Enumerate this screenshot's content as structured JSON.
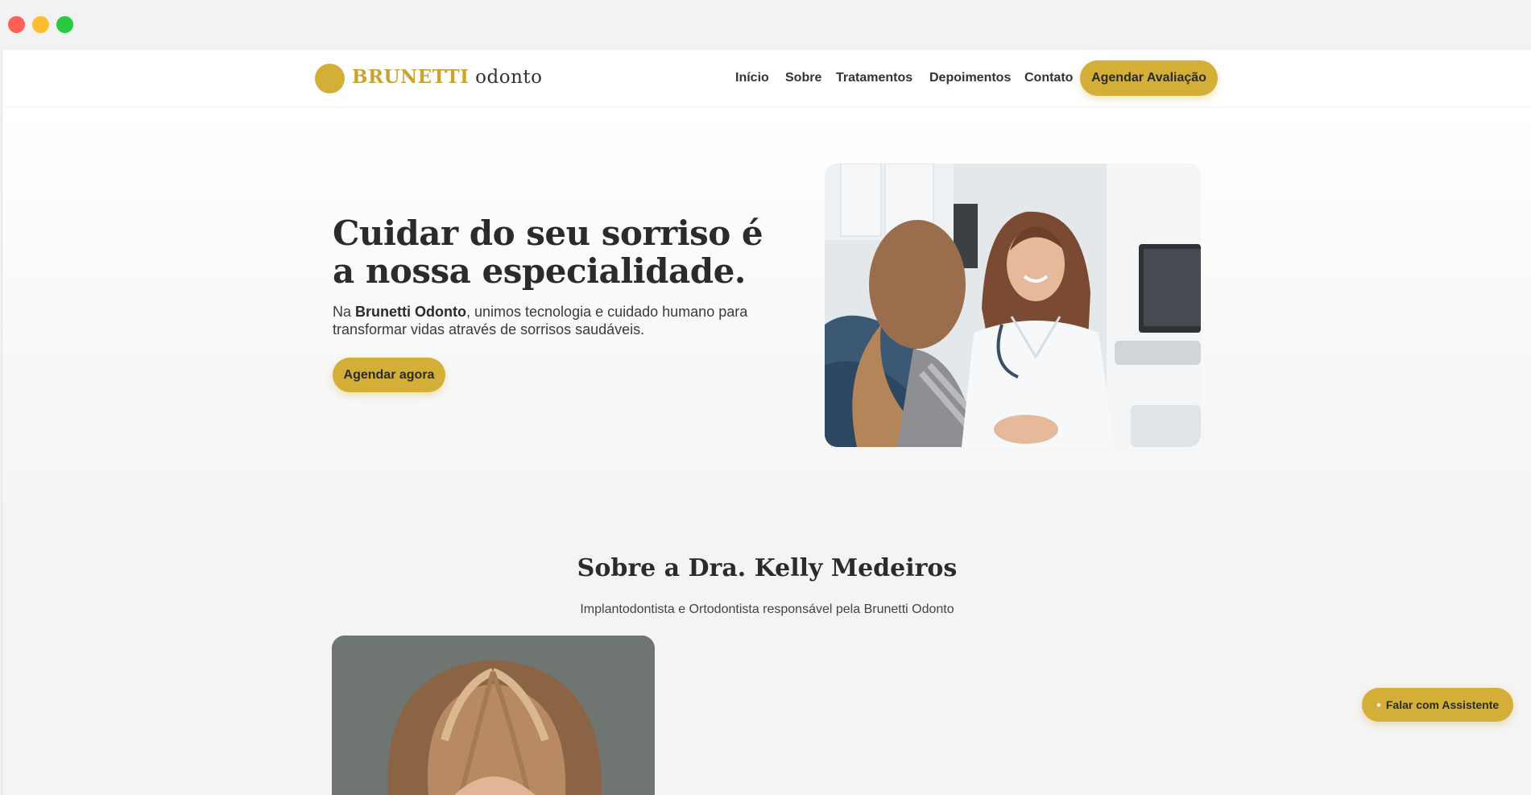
{
  "header": {
    "logo_brand": "BRUNETTI",
    "logo_sub": "odonto",
    "nav": [
      "Início",
      "Sobre",
      "Tratamentos",
      "Depoimentos",
      "Contato"
    ],
    "cta_label": "Agendar Avaliação"
  },
  "hero": {
    "title": "Cuidar do seu sorriso é a nossa especialidade.",
    "text_prefix": "Na ",
    "text_brand": "Brunetti Odonto",
    "text_suffix": ", unimos tecnologia e cuidado humano para transformar vidas através de sorrisos saudáveis.",
    "cta_label": "Agendar agora"
  },
  "about": {
    "title": "Sobre a Dra. Kelly Medeiros",
    "subtitle": "Implantodontista e Ortodontista responsável pela Brunetti Odonto"
  },
  "floating": {
    "label": "Falar com Assistente",
    "icon": "chat-bubble-icon"
  },
  "colors": {
    "accent": "#d4af37",
    "text": "#2b2b2b",
    "background": "#f4f4f4"
  }
}
